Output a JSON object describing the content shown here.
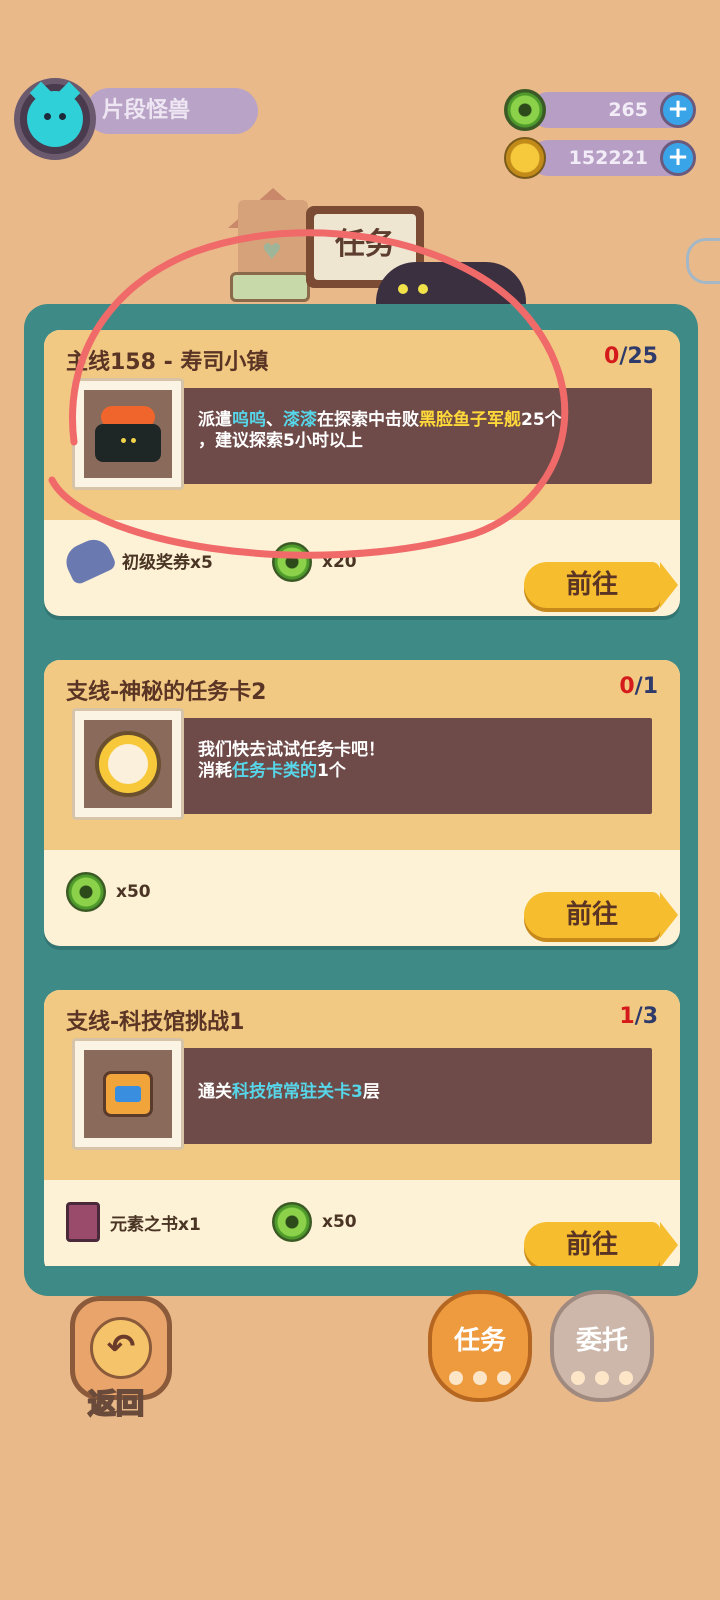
{
  "player": {
    "name": "片段怪兽"
  },
  "currencies": [
    {
      "icon": "green-donut-coin-icon",
      "value": "265"
    },
    {
      "icon": "gold-planet-coin-icon",
      "value": "152221"
    }
  ],
  "header": {
    "title": "任务"
  },
  "tasks": [
    {
      "title": "主线158 - 寿司小镇",
      "progress_current": "0",
      "progress_total": "/25",
      "icon": "sushi-icon",
      "desc": {
        "p1": "派遣",
        "h1": "呜呜",
        "p2": "、",
        "h2": "漆漆",
        "p3": "在探索中击败",
        "h3": "黑脸鱼子军舰",
        "p4": "25个",
        "line2": "，建议探索5小时以上"
      },
      "rewards": [
        {
          "icon": "paw-ticket-icon",
          "label": "初级奖券x5"
        },
        {
          "icon": "green-donut-coin-icon",
          "label": "x20"
        }
      ],
      "button": "前往"
    },
    {
      "title": "支线-神秘的任务卡2",
      "progress_current": "0",
      "progress_total": "/1",
      "icon": "clock-card-icon",
      "desc": {
        "line1": "我们快去试试任务卡吧！",
        "p1": "消耗",
        "h1": "任务卡类的",
        "p2": "1个"
      },
      "rewards": [
        {
          "icon": "green-donut-coin-icon",
          "label": "x50"
        }
      ],
      "button": "前往"
    },
    {
      "title": "支线-科技馆挑战1",
      "progress_current": "1",
      "progress_total": "/3",
      "icon": "robot-icon",
      "desc": {
        "p1": "通关",
        "h1": "科技馆常驻关卡3",
        "p2": "层"
      },
      "rewards": [
        {
          "icon": "element-book-icon",
          "label": "元素之书x1"
        },
        {
          "icon": "green-donut-coin-icon",
          "label": "x50"
        }
      ],
      "button": "前往"
    }
  ],
  "bottom_nav": {
    "back": "返回",
    "tab_tasks": "任务",
    "tab_commission": "委托"
  },
  "colors": {
    "background": "#e9b98a",
    "panel": "#3d8a86",
    "highlight_cyan": "#56d6e8",
    "highlight_yellow": "#ffd93a",
    "progress_red": "#d41a1a",
    "annotation": "#f06a6a"
  }
}
